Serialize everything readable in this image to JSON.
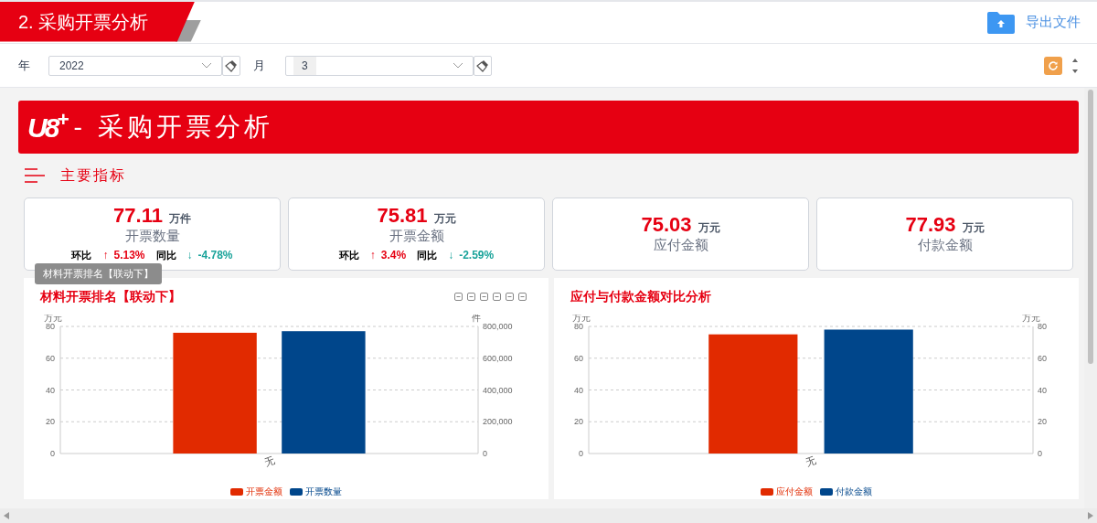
{
  "header": {
    "title": "2. 采购开票分析",
    "export_button": "导出文件"
  },
  "filters": [
    {
      "label": "年",
      "value": "2022",
      "kind": "text"
    },
    {
      "label": "月",
      "value": "3",
      "kind": "tag"
    }
  ],
  "banner": {
    "logo": "U8$^{+}$",
    "title": "- 采购开票分析"
  },
  "section": {
    "title": "主要指标"
  },
  "kpis": [
    {
      "value": "77.11",
      "unit": "万件",
      "label": "开票数量",
      "comparisons": [
        {
          "label": "环比",
          "color": "#e60012",
          "arrow": "↑",
          "value": "5.13%"
        },
        {
          "label": "同比",
          "color": "#1aa39a",
          "arrow": "↓",
          "value": "-4.78%"
        }
      ]
    },
    {
      "value": "75.81",
      "unit": "万元",
      "label": "开票金额",
      "comparisons": [
        {
          "label": "环比",
          "color": "#e60012",
          "arrow": "↑",
          "value": "3.4%"
        },
        {
          "label": "同比",
          "color": "#1aa39a",
          "arrow": "↓",
          "value": "-2.59%"
        }
      ]
    },
    {
      "value": "75.03",
      "unit": "万元",
      "label": "应付金额"
    },
    {
      "value": "77.93",
      "unit": "万元",
      "label": "付款金额"
    }
  ],
  "tooltip": "材料开票排名【联动下】",
  "charts": [
    {
      "title": "材料开票排名【联动下】",
      "toolbox": true,
      "right_axis": {
        "unit": "件",
        "ticks": [
          "800,000",
          "600,000",
          "400,000",
          "200,000",
          "0"
        ]
      },
      "chart_data": {
        "type": "bar",
        "ylabel": "万元",
        "categories": [
          "无"
        ],
        "grid": true,
        "legend": "bottom",
        "series": [
          {
            "name": "开票金额",
            "color": "#e12a00",
            "values": [
              76
            ]
          },
          {
            "name": "开票数量",
            "color": "#00468b",
            "values": [
              77
            ]
          }
        ],
        "ylim": [
          0,
          80
        ],
        "yticks": [
          0,
          20,
          40,
          60,
          80
        ]
      }
    },
    {
      "title": "应付与付款金额对比分析",
      "toolbox": false,
      "right_axis": {
        "unit": "万元",
        "ticks": [
          "80",
          "60",
          "40",
          "20",
          "0"
        ]
      },
      "chart_data": {
        "type": "bar",
        "ylabel": "万元",
        "categories": [
          "无"
        ],
        "grid": true,
        "legend": "bottom",
        "series": [
          {
            "name": "应付金额",
            "color": "#e12a00",
            "values": [
              75
            ]
          },
          {
            "name": "付款金额",
            "color": "#00468b",
            "values": [
              78
            ]
          }
        ],
        "ylim": [
          0,
          80
        ],
        "yticks": [
          0,
          20,
          40,
          60,
          80
        ]
      }
    }
  ]
}
